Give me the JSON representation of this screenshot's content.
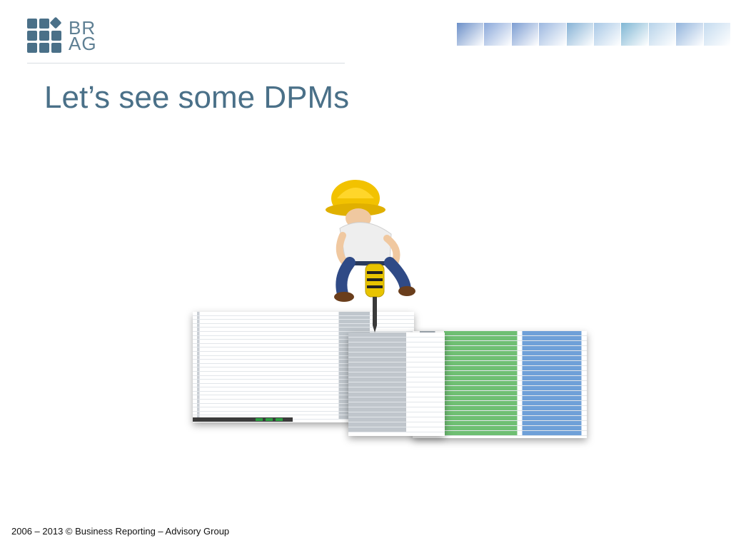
{
  "logo": {
    "line1": "BR",
    "line2": "AG"
  },
  "slide": {
    "title": "Let’s see some DPMs"
  },
  "footer": {
    "text": "2006 – 2013 © Business Reporting – Advisory Group"
  },
  "decor": {
    "strip_colors": [
      "#6b8fc8",
      "#8aa8da",
      "#7c9dd2",
      "#9cb8e0",
      "#86b2d6",
      "#a8c8e6",
      "#7fb6d4",
      "#b7d3ea",
      "#92b4dc",
      "#c4dbef"
    ],
    "worker_icon": "construction-worker-jackhammer-icon"
  },
  "colors": {
    "accent": "#4a7088"
  }
}
